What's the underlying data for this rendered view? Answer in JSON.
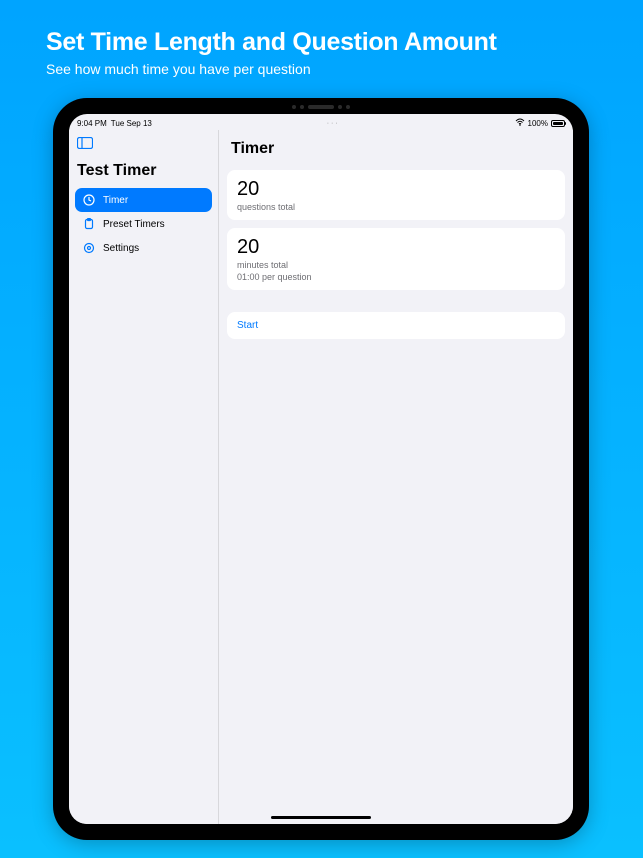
{
  "promo": {
    "title": "Set Time Length and Question Amount",
    "subtitle": "See how much time you have per question"
  },
  "status": {
    "time": "9:04 PM",
    "date": "Tue Sep 13",
    "battery_pct": "100%"
  },
  "sidebar": {
    "title": "Test Timer",
    "items": [
      {
        "label": "Timer",
        "active": true
      },
      {
        "label": "Preset Timers",
        "active": false
      },
      {
        "label": "Settings",
        "active": false
      }
    ]
  },
  "main": {
    "title": "Timer",
    "questions_value": "20",
    "questions_label": "questions total",
    "minutes_value": "20",
    "minutes_label": "minutes total",
    "per_question": "01:00 per question",
    "start_label": "Start"
  }
}
